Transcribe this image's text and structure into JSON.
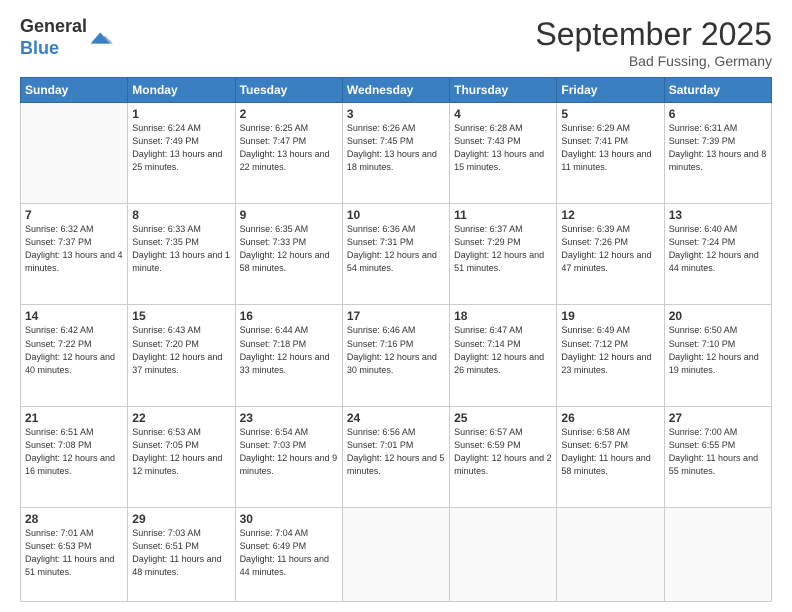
{
  "logo": {
    "general": "General",
    "blue": "Blue"
  },
  "header": {
    "month": "September 2025",
    "location": "Bad Fussing, Germany"
  },
  "weekdays": [
    "Sunday",
    "Monday",
    "Tuesday",
    "Wednesday",
    "Thursday",
    "Friday",
    "Saturday"
  ],
  "weeks": [
    [
      {
        "day": "",
        "sunrise": "",
        "sunset": "",
        "daylight": ""
      },
      {
        "day": "1",
        "sunrise": "Sunrise: 6:24 AM",
        "sunset": "Sunset: 7:49 PM",
        "daylight": "Daylight: 13 hours and 25 minutes."
      },
      {
        "day": "2",
        "sunrise": "Sunrise: 6:25 AM",
        "sunset": "Sunset: 7:47 PM",
        "daylight": "Daylight: 13 hours and 22 minutes."
      },
      {
        "day": "3",
        "sunrise": "Sunrise: 6:26 AM",
        "sunset": "Sunset: 7:45 PM",
        "daylight": "Daylight: 13 hours and 18 minutes."
      },
      {
        "day": "4",
        "sunrise": "Sunrise: 6:28 AM",
        "sunset": "Sunset: 7:43 PM",
        "daylight": "Daylight: 13 hours and 15 minutes."
      },
      {
        "day": "5",
        "sunrise": "Sunrise: 6:29 AM",
        "sunset": "Sunset: 7:41 PM",
        "daylight": "Daylight: 13 hours and 11 minutes."
      },
      {
        "day": "6",
        "sunrise": "Sunrise: 6:31 AM",
        "sunset": "Sunset: 7:39 PM",
        "daylight": "Daylight: 13 hours and 8 minutes."
      }
    ],
    [
      {
        "day": "7",
        "sunrise": "Sunrise: 6:32 AM",
        "sunset": "Sunset: 7:37 PM",
        "daylight": "Daylight: 13 hours and 4 minutes."
      },
      {
        "day": "8",
        "sunrise": "Sunrise: 6:33 AM",
        "sunset": "Sunset: 7:35 PM",
        "daylight": "Daylight: 13 hours and 1 minute."
      },
      {
        "day": "9",
        "sunrise": "Sunrise: 6:35 AM",
        "sunset": "Sunset: 7:33 PM",
        "daylight": "Daylight: 12 hours and 58 minutes."
      },
      {
        "day": "10",
        "sunrise": "Sunrise: 6:36 AM",
        "sunset": "Sunset: 7:31 PM",
        "daylight": "Daylight: 12 hours and 54 minutes."
      },
      {
        "day": "11",
        "sunrise": "Sunrise: 6:37 AM",
        "sunset": "Sunset: 7:29 PM",
        "daylight": "Daylight: 12 hours and 51 minutes."
      },
      {
        "day": "12",
        "sunrise": "Sunrise: 6:39 AM",
        "sunset": "Sunset: 7:26 PM",
        "daylight": "Daylight: 12 hours and 47 minutes."
      },
      {
        "day": "13",
        "sunrise": "Sunrise: 6:40 AM",
        "sunset": "Sunset: 7:24 PM",
        "daylight": "Daylight: 12 hours and 44 minutes."
      }
    ],
    [
      {
        "day": "14",
        "sunrise": "Sunrise: 6:42 AM",
        "sunset": "Sunset: 7:22 PM",
        "daylight": "Daylight: 12 hours and 40 minutes."
      },
      {
        "day": "15",
        "sunrise": "Sunrise: 6:43 AM",
        "sunset": "Sunset: 7:20 PM",
        "daylight": "Daylight: 12 hours and 37 minutes."
      },
      {
        "day": "16",
        "sunrise": "Sunrise: 6:44 AM",
        "sunset": "Sunset: 7:18 PM",
        "daylight": "Daylight: 12 hours and 33 minutes."
      },
      {
        "day": "17",
        "sunrise": "Sunrise: 6:46 AM",
        "sunset": "Sunset: 7:16 PM",
        "daylight": "Daylight: 12 hours and 30 minutes."
      },
      {
        "day": "18",
        "sunrise": "Sunrise: 6:47 AM",
        "sunset": "Sunset: 7:14 PM",
        "daylight": "Daylight: 12 hours and 26 minutes."
      },
      {
        "day": "19",
        "sunrise": "Sunrise: 6:49 AM",
        "sunset": "Sunset: 7:12 PM",
        "daylight": "Daylight: 12 hours and 23 minutes."
      },
      {
        "day": "20",
        "sunrise": "Sunrise: 6:50 AM",
        "sunset": "Sunset: 7:10 PM",
        "daylight": "Daylight: 12 hours and 19 minutes."
      }
    ],
    [
      {
        "day": "21",
        "sunrise": "Sunrise: 6:51 AM",
        "sunset": "Sunset: 7:08 PM",
        "daylight": "Daylight: 12 hours and 16 minutes."
      },
      {
        "day": "22",
        "sunrise": "Sunrise: 6:53 AM",
        "sunset": "Sunset: 7:05 PM",
        "daylight": "Daylight: 12 hours and 12 minutes."
      },
      {
        "day": "23",
        "sunrise": "Sunrise: 6:54 AM",
        "sunset": "Sunset: 7:03 PM",
        "daylight": "Daylight: 12 hours and 9 minutes."
      },
      {
        "day": "24",
        "sunrise": "Sunrise: 6:56 AM",
        "sunset": "Sunset: 7:01 PM",
        "daylight": "Daylight: 12 hours and 5 minutes."
      },
      {
        "day": "25",
        "sunrise": "Sunrise: 6:57 AM",
        "sunset": "Sunset: 6:59 PM",
        "daylight": "Daylight: 12 hours and 2 minutes."
      },
      {
        "day": "26",
        "sunrise": "Sunrise: 6:58 AM",
        "sunset": "Sunset: 6:57 PM",
        "daylight": "Daylight: 11 hours and 58 minutes."
      },
      {
        "day": "27",
        "sunrise": "Sunrise: 7:00 AM",
        "sunset": "Sunset: 6:55 PM",
        "daylight": "Daylight: 11 hours and 55 minutes."
      }
    ],
    [
      {
        "day": "28",
        "sunrise": "Sunrise: 7:01 AM",
        "sunset": "Sunset: 6:53 PM",
        "daylight": "Daylight: 11 hours and 51 minutes."
      },
      {
        "day": "29",
        "sunrise": "Sunrise: 7:03 AM",
        "sunset": "Sunset: 6:51 PM",
        "daylight": "Daylight: 11 hours and 48 minutes."
      },
      {
        "day": "30",
        "sunrise": "Sunrise: 7:04 AM",
        "sunset": "Sunset: 6:49 PM",
        "daylight": "Daylight: 11 hours and 44 minutes."
      },
      {
        "day": "",
        "sunrise": "",
        "sunset": "",
        "daylight": ""
      },
      {
        "day": "",
        "sunrise": "",
        "sunset": "",
        "daylight": ""
      },
      {
        "day": "",
        "sunrise": "",
        "sunset": "",
        "daylight": ""
      },
      {
        "day": "",
        "sunrise": "",
        "sunset": "",
        "daylight": ""
      }
    ]
  ]
}
